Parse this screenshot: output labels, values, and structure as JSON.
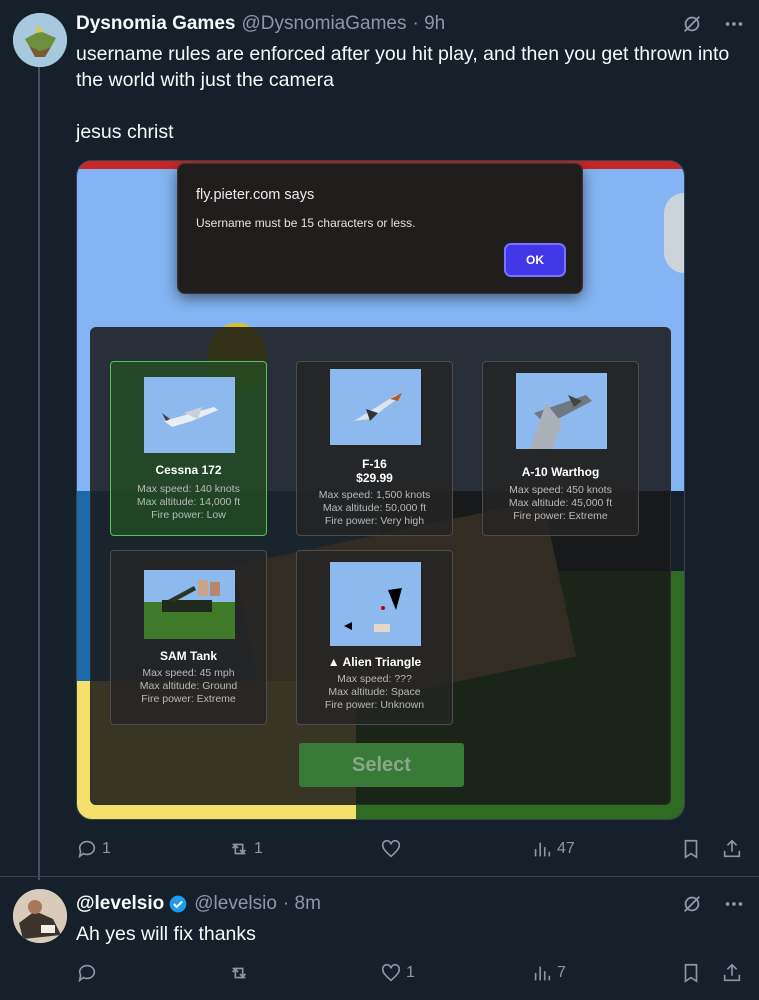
{
  "tweet1": {
    "name": "Dysnomia Games",
    "handle": "@DysnomiaGames",
    "time": "· 9h",
    "text_line1": "username rules are enforced after you hit play, and then you get thrown into the world with just the camera",
    "text_line2": "jesus christ",
    "actions": {
      "reply": "1",
      "retweet": "1",
      "like": "",
      "views": "47"
    }
  },
  "media": {
    "dialog": {
      "title": "fly.pieter.com says",
      "message": "Username must be 15 characters or less.",
      "ok_label": "OK"
    },
    "planes": [
      {
        "name": "Cessna 172",
        "speed": "Max speed: 140 knots",
        "altitude": "Max altitude: 14,000 ft",
        "power": "Fire power: Low"
      },
      {
        "name": "F-16",
        "price": "$29.99",
        "speed": "Max speed: 1,500 knots",
        "altitude": "Max altitude: 50,000 ft",
        "power": "Fire power: Very high"
      },
      {
        "name": "A-10 Warthog",
        "speed": "Max speed: 450 knots",
        "altitude": "Max altitude: 45,000 ft",
        "power": "Fire power: Extreme"
      },
      {
        "name": "SAM Tank",
        "speed": "Max speed: 45 mph",
        "altitude": "Max altitude: Ground",
        "power": "Fire power: Extreme"
      },
      {
        "name": "▲ Alien Triangle",
        "speed": "Max speed: ???",
        "altitude": "Max altitude: Space",
        "power": "Fire power: Unknown"
      }
    ],
    "select_label": "Select"
  },
  "tweet2": {
    "name": "@levelsio",
    "handle": "@levelsio",
    "time": "· 8m",
    "text": "Ah yes will fix thanks",
    "actions": {
      "reply": "",
      "retweet": "",
      "like": "1",
      "views": "7"
    }
  },
  "colors": {
    "background": "#15202b",
    "muted": "#8b98a5",
    "verified": "#1d9bf0",
    "ok_button": "#4137e6",
    "select_button": "#3a7a39"
  }
}
